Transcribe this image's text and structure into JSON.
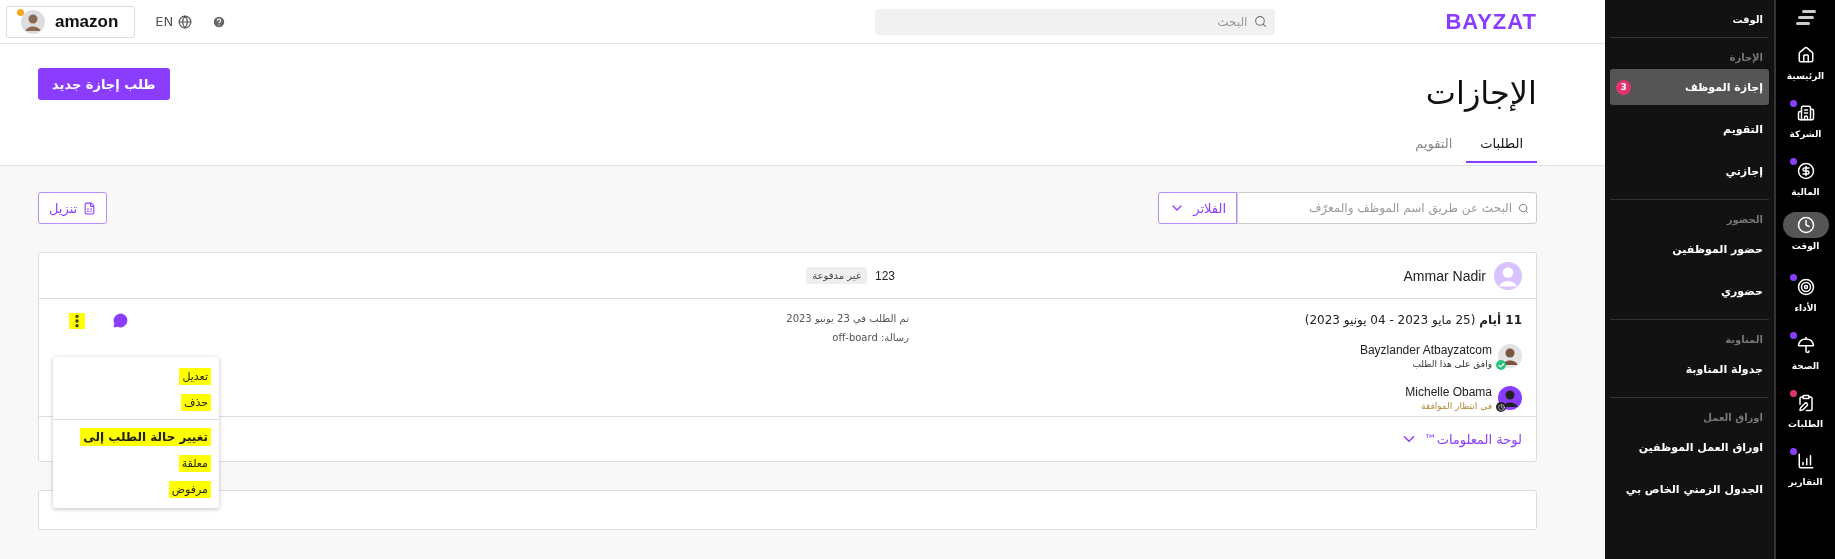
{
  "topbar": {
    "account": {
      "company": "amazon",
      "notification": true
    },
    "language": "EN",
    "search": {
      "placeholder": "البحث"
    },
    "logo": "BAYZAT"
  },
  "page": {
    "title": "الإجازات",
    "new_button": "طلب إجازة جديد",
    "tabs": [
      {
        "label": "الطلبات",
        "selected": true
      },
      {
        "label": "التقويم",
        "selected": false
      }
    ]
  },
  "toolbar": {
    "search": {
      "placeholder": "البحث عن طريق اسم الموظف والمعرّف"
    },
    "filter_button": "الفلاتر",
    "download_button": "تنزيل"
  },
  "requests": [
    {
      "employee": "Ammar Nadir",
      "id": "123",
      "tag": "غير مدفوعة",
      "duration": "11 أيام",
      "range": "(25 مايو 2023 - 04 يونيو 2023)",
      "requested": "تم الطلب في 23 يونيو 2023",
      "message": "رسالة: off-board",
      "approvers": [
        {
          "name": "Bayzlander Atbayzatcom",
          "status": "وافق على هذا الطلب",
          "kind": "approved"
        },
        {
          "name": "Michelle Obama",
          "status": "في انتظار الموافقة",
          "kind": "pending"
        }
      ],
      "details_link": "لوحة المعلومات™"
    }
  ],
  "menu": {
    "items": [
      {
        "kind": "action",
        "label": "تعديل",
        "highlighted": true
      },
      {
        "kind": "action",
        "label": "حذف",
        "highlighted": true
      },
      {
        "kind": "divider"
      },
      {
        "kind": "heading",
        "label": "تغيير حالة الطلب إلى",
        "highlighted": true
      },
      {
        "kind": "action",
        "label": "معلقة",
        "highlighted": true
      },
      {
        "kind": "action",
        "label": "مرفوض",
        "highlighted": true
      }
    ]
  },
  "submenu": {
    "title": "الوقت",
    "sections": [
      {
        "label": "الإجازة",
        "items": [
          {
            "label": "إجازة الموظف",
            "selected": true,
            "badge": "3"
          },
          {
            "label": "التقويم",
            "selected": false
          },
          {
            "label": "إجازتي",
            "selected": false
          }
        ]
      },
      {
        "label": "الحضور",
        "items": [
          {
            "label": "حضور الموظفين",
            "selected": false
          },
          {
            "label": "حضوري",
            "selected": false
          }
        ]
      },
      {
        "label": "المناوبة",
        "items": [
          {
            "label": "جدولة المناوبة",
            "selected": false
          }
        ]
      },
      {
        "label": "اوراق العمل",
        "items": [
          {
            "label": "اوراق العمل الموظفين",
            "selected": false
          },
          {
            "label": "الجدول الزمني الخاص بي",
            "selected": false
          }
        ]
      }
    ]
  },
  "rail": {
    "items": [
      {
        "kind": "home",
        "label": "الرئيسية",
        "selected": false
      },
      {
        "kind": "company",
        "label": "الشركة",
        "selected": false,
        "color": "#8b3dff"
      },
      {
        "kind": "finance",
        "label": "المالية",
        "selected": false,
        "color": "#8b3dff"
      },
      {
        "kind": "time",
        "label": "الوقت",
        "selected": true
      },
      {
        "kind": "performance",
        "label": "الأداء",
        "selected": false,
        "color": "#8b3dff"
      },
      {
        "kind": "health",
        "label": "الصحة",
        "selected": false,
        "color": "#8b3dff"
      },
      {
        "kind": "requests",
        "label": "الطلبات",
        "selected": false,
        "color": "#e0336f"
      },
      {
        "kind": "reports",
        "label": "التقارير",
        "selected": false,
        "color": "#8b3dff"
      }
    ]
  }
}
